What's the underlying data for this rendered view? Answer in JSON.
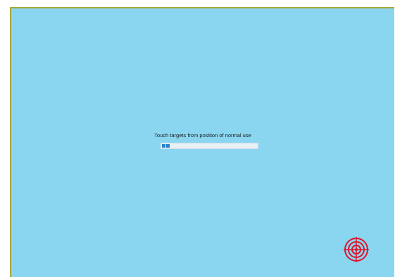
{
  "calibration": {
    "instruction": "Touch targets from position of normal use",
    "progress": 0.08,
    "target_icon": "crosshair-target-icon",
    "colors": {
      "background": "#8ad6f1",
      "frame": "#a6a83e",
      "progress_fill": "#2a7fd0",
      "progress_track": "#e8f0f4",
      "target": "#e0142b"
    }
  }
}
